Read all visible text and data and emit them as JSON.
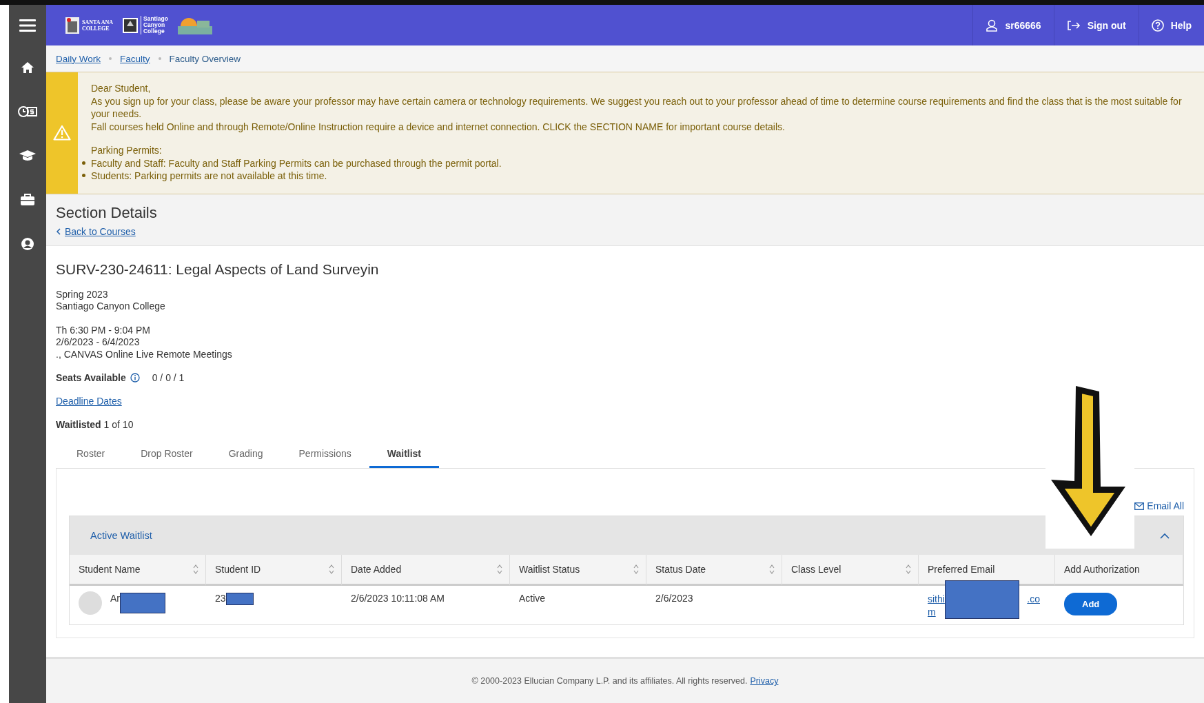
{
  "header": {
    "logos": [
      {
        "kind": "santa-ana",
        "lines": [
          "SANTA ANA",
          "COLLEGE"
        ]
      },
      {
        "kind": "santiago-canyon",
        "lines": [
          "Santiago",
          "Canyon",
          "College"
        ]
      },
      {
        "kind": "district"
      }
    ],
    "actions": [
      {
        "kind": "user",
        "label": "sr66666"
      },
      {
        "kind": "signout",
        "label": "Sign out"
      },
      {
        "kind": "help",
        "label": "Help"
      }
    ]
  },
  "sidebar": {
    "items": [
      {
        "kind": "home"
      },
      {
        "kind": "finance"
      },
      {
        "kind": "academics"
      },
      {
        "kind": "employment"
      },
      {
        "kind": "profile"
      }
    ]
  },
  "breadcrumbs": [
    {
      "label": "Daily Work",
      "link": true
    },
    {
      "label": "Faculty",
      "link": true
    },
    {
      "label": "Faculty Overview",
      "link": false
    }
  ],
  "alert": {
    "greeting": "Dear Student,",
    "lines": [
      "As you sign up for your class, please be aware your professor may have certain camera or technology requirements. We suggest you reach out to your professor ahead of time to determine course requirements and find the class that is the most suitable for your needs.",
      "Fall courses held Online and through Remote/Online Instruction require a device and internet connection. CLICK the SECTION NAME for important course details."
    ],
    "subheading": "Parking Permits:",
    "bullets": [
      "Faculty and Staff: Faculty and Staff Parking Permits can be purchased through the permit portal.",
      "Students: Parking permits are not available at this time."
    ]
  },
  "page_title": "Section Details",
  "back_link": "Back to Courses",
  "section": {
    "title": "SURV-230-24611: Legal Aspects of Land Surveyin",
    "term": [
      "Spring 2023",
      "Santiago Canyon College"
    ],
    "meeting": [
      "Th 6:30 PM - 9:04 PM",
      "2/6/2023 - 6/4/2023",
      "., CANVAS Online Live Remote Meetings"
    ],
    "seats_label": "Seats Available",
    "seats_value": "0 / 0 / 1",
    "deadline_link": "Deadline Dates",
    "waitlisted_label": "Waitlisted",
    "waitlisted_value": "1 of 10"
  },
  "tabs": [
    {
      "label": "Roster",
      "selected": false
    },
    {
      "label": "Drop Roster",
      "selected": false
    },
    {
      "label": "Grading",
      "selected": false
    },
    {
      "label": "Permissions",
      "selected": false
    },
    {
      "label": "Waitlist",
      "selected": true
    }
  ],
  "email_all": "Email All",
  "waitlist": {
    "title": "Active Waitlist",
    "expanded": true,
    "columns": [
      {
        "label": "Student Name",
        "sortable": true
      },
      {
        "label": "Student ID",
        "sortable": true
      },
      {
        "label": "Date Added",
        "sortable": true
      },
      {
        "label": "Waitlist Status",
        "sortable": true
      },
      {
        "label": "Status Date",
        "sortable": true
      },
      {
        "label": "Class Level",
        "sortable": true
      },
      {
        "label": "Preferred Email",
        "sortable": false
      },
      {
        "label": "Add Authorization",
        "sortable": false
      }
    ],
    "rows": [
      {
        "name": "Ar",
        "student_id": "23",
        "date_added": "2/6/2023 10:11:08 AM",
        "status": "Active",
        "status_date": "2/6/2023",
        "email_start": "sithi",
        "email_end": ".co",
        "email_wrap": "m",
        "action": "Add"
      }
    ]
  },
  "footer": {
    "text": "© 2000-2023 Ellucian Company L.P. and its affiliates. All rights reserved.",
    "link": "Privacy"
  }
}
